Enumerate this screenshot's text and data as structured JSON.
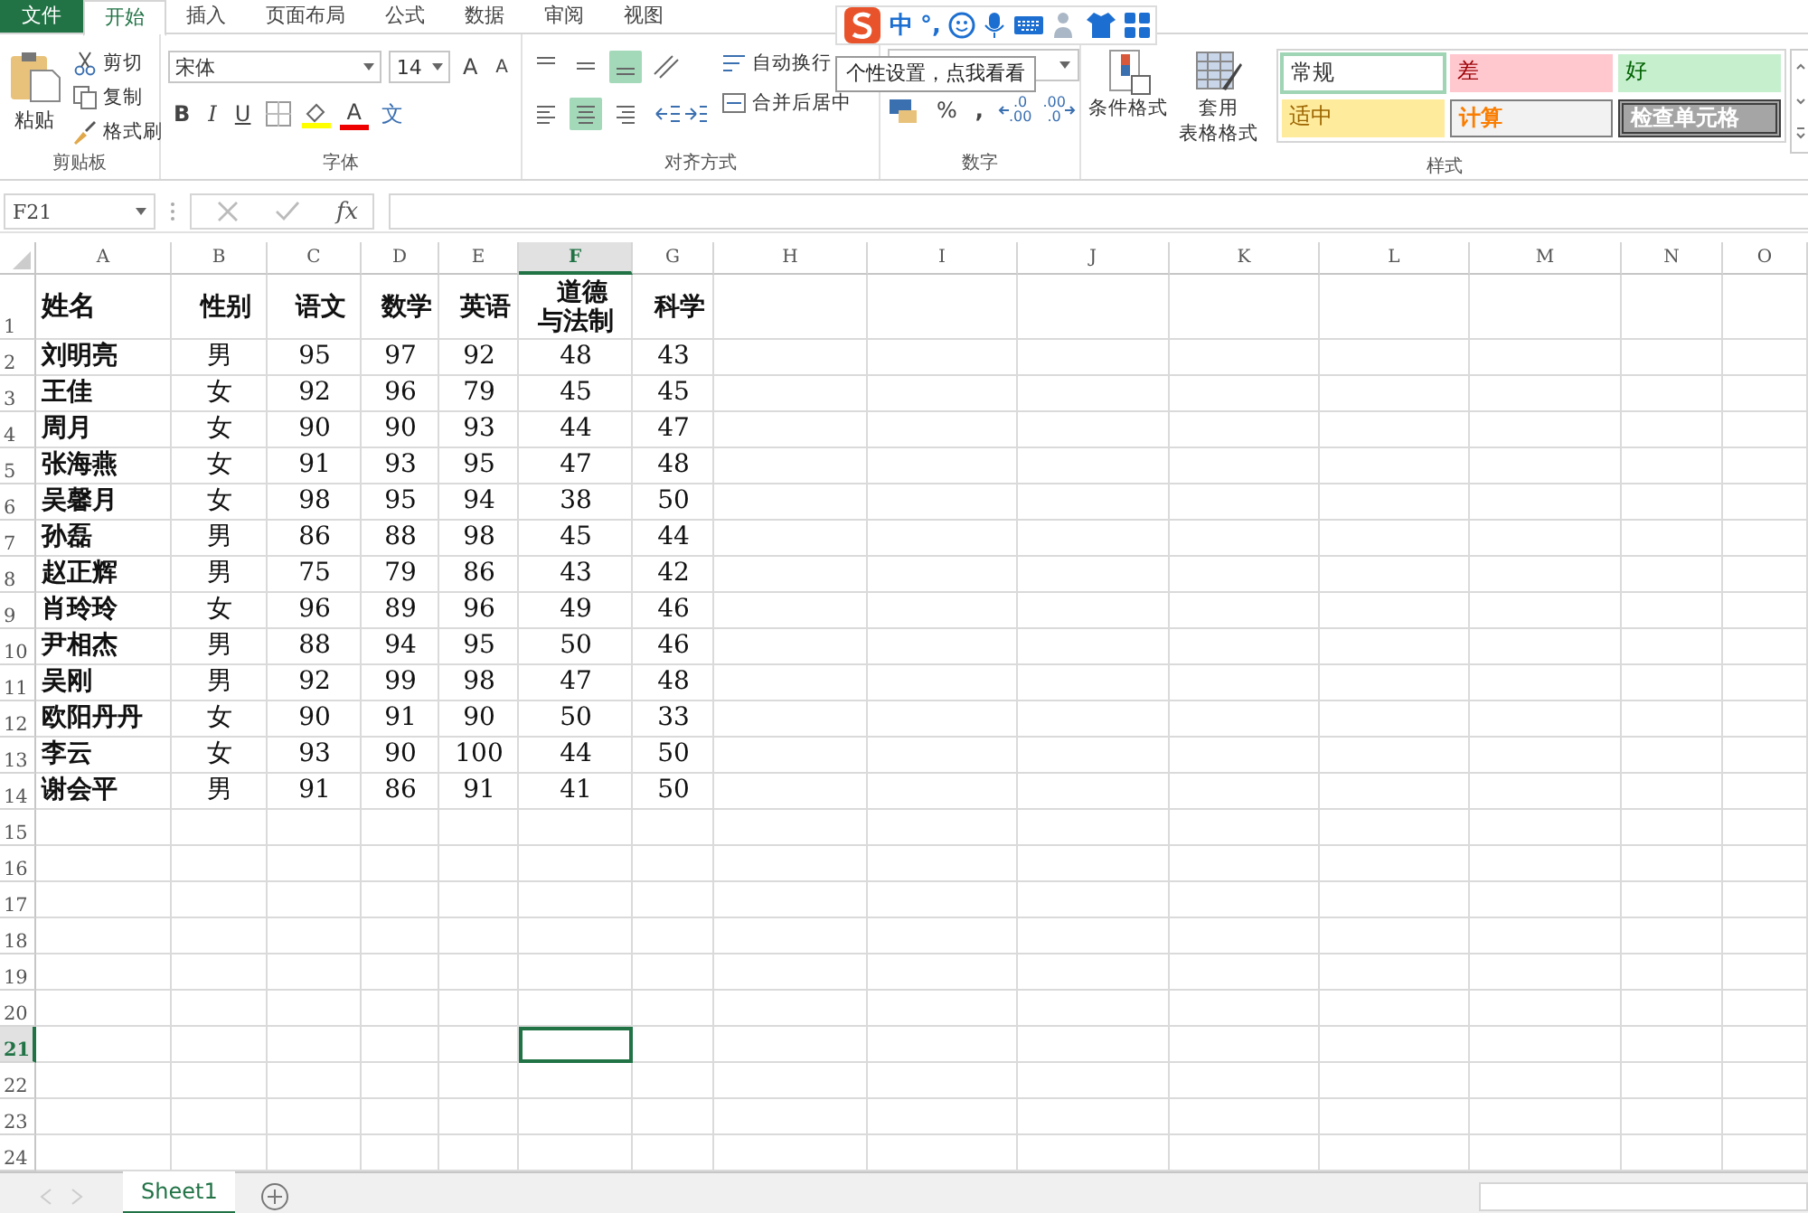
{
  "menu_tabs": [
    {
      "label": "文件",
      "kind": "file",
      "selected": false
    },
    {
      "label": "开始",
      "kind": "tab",
      "selected": true
    },
    {
      "label": "插入",
      "kind": "tab",
      "selected": false
    },
    {
      "label": "页面布局",
      "kind": "tab",
      "selected": false
    },
    {
      "label": "公式",
      "kind": "tab",
      "selected": false
    },
    {
      "label": "数据",
      "kind": "tab",
      "selected": false
    },
    {
      "label": "审阅",
      "kind": "tab",
      "selected": false
    },
    {
      "label": "视图",
      "kind": "tab",
      "selected": false
    }
  ],
  "clipboard": {
    "paste": "粘贴",
    "cut": "剪切",
    "copy": "复制",
    "format_painter": "格式刷",
    "label": "剪贴板"
  },
  "font": {
    "family": "宋体",
    "size": "14",
    "grow": "A",
    "shrink": "A",
    "bold": "B",
    "italic": "I",
    "underline": "U",
    "font_color": "A",
    "phonetic": "文",
    "label": "字体"
  },
  "alignment": {
    "vertical": [
      {
        "selected": false
      },
      {
        "selected": false
      },
      {
        "selected": true
      }
    ],
    "horizontal": [
      {
        "selected": false
      },
      {
        "selected": true
      },
      {
        "selected": false
      }
    ],
    "wrap": "自动换行",
    "merge": "合并后居中",
    "label": "对齐方式"
  },
  "number": {
    "percent": "%",
    "comma": ",",
    "decimals": [
      {
        "kind": "increase",
        "top": ".0",
        "bottom": ".00"
      },
      {
        "kind": "decrease",
        "top": ".00",
        "bottom": ".0"
      }
    ],
    "label": "数字"
  },
  "styles": {
    "conditional": "条件格式",
    "table_format_top": "套用",
    "table_format_bottom": "表格格式",
    "label": "样式",
    "cells": [
      {
        "label": "常规",
        "kind": "normal",
        "selected": true
      },
      {
        "label": "差",
        "kind": "bad",
        "selected": false
      },
      {
        "label": "好",
        "kind": "good",
        "selected": false
      },
      {
        "label": "适中",
        "kind": "neutral",
        "selected": false
      },
      {
        "label": "计算",
        "kind": "calculation",
        "selected": false
      },
      {
        "label": "检查单元格",
        "kind": "check",
        "selected": false
      }
    ]
  },
  "ime_toolbar": {
    "mode": "中",
    "punctuation": "°,"
  },
  "tooltip": "个性设置，点我看看",
  "formula_bar": {
    "name_box": "F21",
    "function": "fx"
  },
  "columns": [
    {
      "label": "A",
      "selected": false
    },
    {
      "label": "B",
      "selected": false
    },
    {
      "label": "C",
      "selected": false
    },
    {
      "label": "D",
      "selected": false
    },
    {
      "label": "E",
      "selected": false
    },
    {
      "label": "F",
      "selected": true
    },
    {
      "label": "G",
      "selected": false
    },
    {
      "label": "H",
      "selected": false
    },
    {
      "label": "I",
      "selected": false
    },
    {
      "label": "J",
      "selected": false
    },
    {
      "label": "K",
      "selected": false
    },
    {
      "label": "L",
      "selected": false
    },
    {
      "label": "M",
      "selected": false
    },
    {
      "label": "N",
      "selected": false
    },
    {
      "label": "O",
      "selected": false
    }
  ],
  "rows": [
    {
      "label": "1",
      "selected": false,
      "cells": [
        "姓名",
        "性别",
        "语文",
        "数学",
        "英语",
        "道德与法制",
        "科学"
      ]
    },
    {
      "label": "2",
      "selected": false,
      "cells": [
        "刘明亮",
        "男",
        "95",
        "97",
        "92",
        "48",
        "43"
      ]
    },
    {
      "label": "3",
      "selected": false,
      "cells": [
        "王佳",
        "女",
        "92",
        "96",
        "79",
        "45",
        "45"
      ]
    },
    {
      "label": "4",
      "selected": false,
      "cells": [
        "周月",
        "女",
        "90",
        "90",
        "93",
        "44",
        "47"
      ]
    },
    {
      "label": "5",
      "selected": false,
      "cells": [
        "张海燕",
        "女",
        "91",
        "93",
        "95",
        "47",
        "48"
      ]
    },
    {
      "label": "6",
      "selected": false,
      "cells": [
        "吴馨月",
        "女",
        "98",
        "95",
        "94",
        "38",
        "50"
      ]
    },
    {
      "label": "7",
      "selected": false,
      "cells": [
        "孙磊",
        "男",
        "86",
        "88",
        "98",
        "45",
        "44"
      ]
    },
    {
      "label": "8",
      "selected": false,
      "cells": [
        "赵正辉",
        "男",
        "75",
        "79",
        "86",
        "43",
        "42"
      ]
    },
    {
      "label": "9",
      "selected": false,
      "cells": [
        "肖玲玲",
        "女",
        "96",
        "89",
        "96",
        "49",
        "46"
      ]
    },
    {
      "label": "10",
      "selected": false,
      "cells": [
        "尹相杰",
        "男",
        "88",
        "94",
        "95",
        "50",
        "46"
      ]
    },
    {
      "label": "11",
      "selected": false,
      "cells": [
        "吴刚",
        "男",
        "92",
        "99",
        "98",
        "47",
        "48"
      ]
    },
    {
      "label": "12",
      "selected": false,
      "cells": [
        "欧阳丹丹",
        "女",
        "90",
        "91",
        "90",
        "50",
        "33"
      ]
    },
    {
      "label": "13",
      "selected": false,
      "cells": [
        "李云",
        "女",
        "93",
        "90",
        "100",
        "44",
        "50"
      ]
    },
    {
      "label": "14",
      "selected": false,
      "cells": [
        "谢会平",
        "男",
        "91",
        "86",
        "91",
        "41",
        "50"
      ]
    },
    {
      "label": "15",
      "selected": false,
      "cells": []
    },
    {
      "label": "16",
      "selected": false,
      "cells": []
    },
    {
      "label": "17",
      "selected": false,
      "cells": []
    },
    {
      "label": "18",
      "selected": false,
      "cells": []
    },
    {
      "label": "19",
      "selected": false,
      "cells": []
    },
    {
      "label": "20",
      "selected": false,
      "cells": []
    },
    {
      "label": "21",
      "selected": true,
      "cells": []
    },
    {
      "label": "22",
      "selected": false,
      "cells": []
    },
    {
      "label": "23",
      "selected": false,
      "cells": []
    },
    {
      "label": "24",
      "selected": false,
      "cells": []
    }
  ],
  "sheet_tabs": [
    {
      "label": "Sheet1",
      "selected": true
    }
  ]
}
